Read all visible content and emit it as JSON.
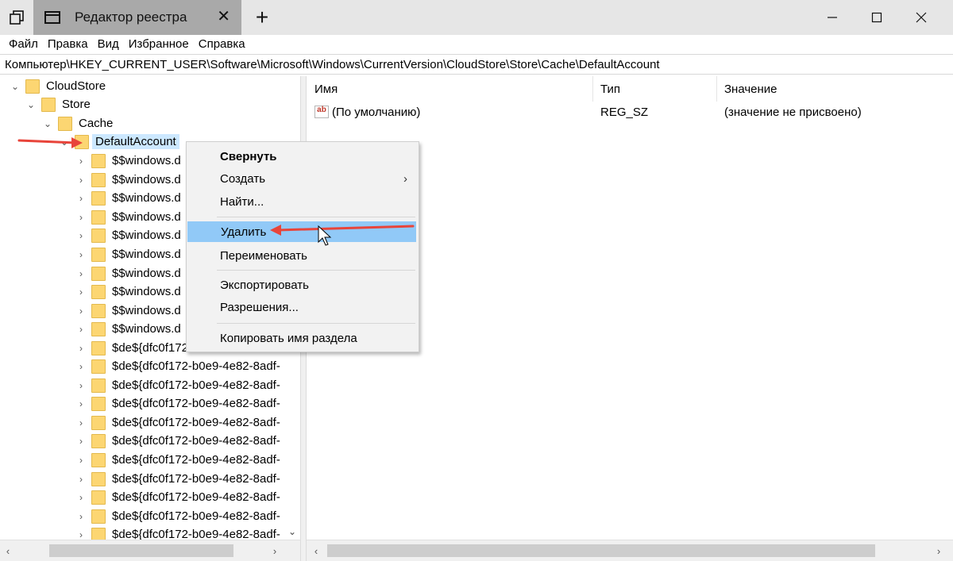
{
  "window": {
    "tab_title": "Редактор реестра",
    "tab_close_glyph": "✕",
    "new_tab_glyph": "+"
  },
  "menubar": {
    "items": [
      "Файл",
      "Правка",
      "Вид",
      "Избранное",
      "Справка"
    ]
  },
  "address": {
    "path": "Компьютер\\HKEY_CURRENT_USER\\Software\\Microsoft\\Windows\\CurrentVersion\\CloudStore\\Store\\Cache\\DefaultAccount"
  },
  "tree": {
    "cloudstore": "CloudStore",
    "store": "Store",
    "cache": "Cache",
    "default_account": "DefaultAccount",
    "windows_items": [
      "$$windows.d",
      "$$windows.d",
      "$$windows.d",
      "$$windows.d",
      "$$windows.d",
      "$$windows.d",
      "$$windows.d",
      "$$windows.d",
      "$$windows.d",
      "$$windows.d"
    ],
    "de_items": [
      "$de${dfc0f172",
      "$de${dfc0f172-b0e9-4e82-8adf-",
      "$de${dfc0f172-b0e9-4e82-8adf-",
      "$de${dfc0f172-b0e9-4e82-8adf-",
      "$de${dfc0f172-b0e9-4e82-8adf-",
      "$de${dfc0f172-b0e9-4e82-8adf-",
      "$de${dfc0f172-b0e9-4e82-8adf-",
      "$de${dfc0f172-b0e9-4e82-8adf-",
      "$de${dfc0f172-b0e9-4e82-8adf-",
      "$de${dfc0f172-b0e9-4e82-8adf-",
      "$de${dfc0f172-b0e9-4e82-8adf-"
    ]
  },
  "list": {
    "headers": {
      "name": "Имя",
      "type": "Тип",
      "value": "Значение"
    },
    "rows": [
      {
        "icon": "string-value-icon",
        "icon_text": "ab",
        "name": "(По умолчанию)",
        "type": "REG_SZ",
        "value": "(значение не присвоено)"
      }
    ]
  },
  "context_menu": {
    "items": {
      "collapse": "Свернуть",
      "create": "Создать",
      "find": "Найти...",
      "delete": "Удалить",
      "rename": "Переименовать",
      "export": "Экспортировать",
      "permissions": "Разрешения...",
      "copy_key_name": "Копировать имя раздела"
    },
    "submenu_glyph": "›",
    "highlighted": "Удалить"
  },
  "colors": {
    "titlebar_bg": "#e6e6e6",
    "active_tab_bg": "#a9a9a9",
    "selection_bg": "#cce8ff",
    "menu_hover_bg": "#91c9f7",
    "folder_fill": "#fcd672",
    "annotation_red": "#e8443a"
  }
}
